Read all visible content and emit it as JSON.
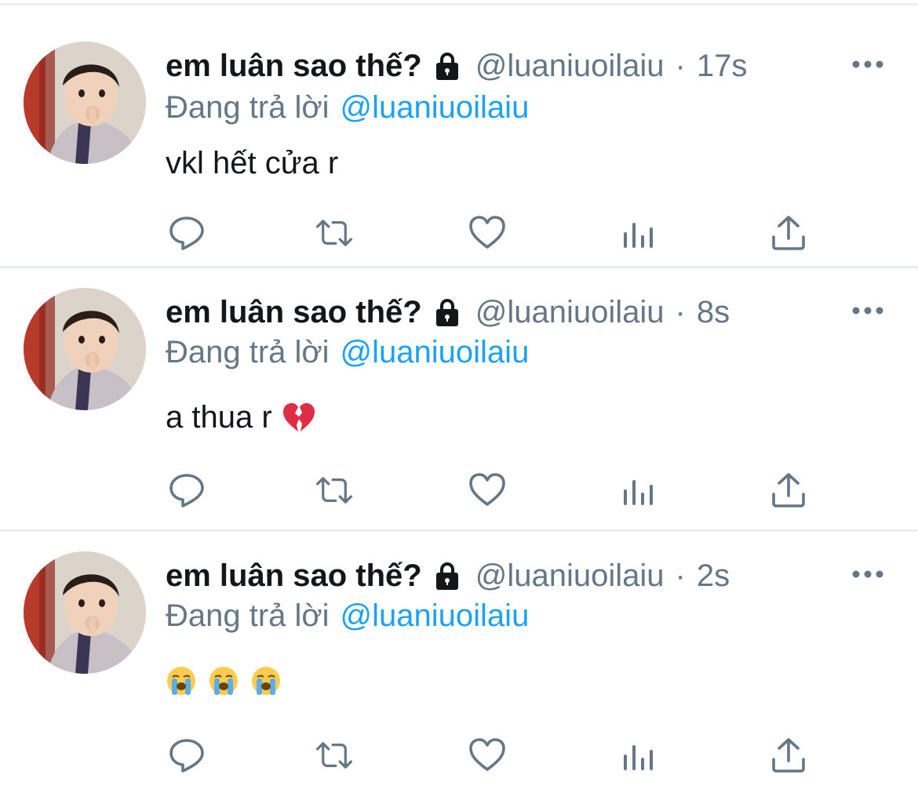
{
  "colors": {
    "text": "#14171a",
    "secondary": "#657786",
    "link": "#1da1f2",
    "divider": "#ebeef0",
    "icon": "#657786"
  },
  "tweets": [
    {
      "display_name": "em luân sao thế?",
      "handle": "@luaniuoilaiu",
      "separator": "·",
      "time": "17s",
      "reply_prefix": "Đang trả lời",
      "reply_to": "@luaniuoilaiu",
      "text": "vkl hết cửa r",
      "emoji": []
    },
    {
      "display_name": "em luân sao thế?",
      "handle": "@luaniuoilaiu",
      "separator": "·",
      "time": "8s",
      "reply_prefix": "Đang trả lời",
      "reply_to": "@luaniuoilaiu",
      "text": "a thua r",
      "emoji": [
        "broken-heart-emoji"
      ]
    },
    {
      "display_name": "em luân sao thế?",
      "handle": "@luaniuoilaiu",
      "separator": "·",
      "time": "2s",
      "reply_prefix": "Đang trả lời",
      "reply_to": "@luaniuoilaiu",
      "text": "",
      "emoji": [
        "loudly-crying-face-emoji",
        "loudly-crying-face-emoji",
        "loudly-crying-face-emoji"
      ]
    }
  ],
  "icons": {
    "lock": "lock-icon",
    "more": "more-icon",
    "reply": "reply-icon",
    "retweet": "retweet-icon",
    "like": "heart-icon",
    "stats": "stats-icon",
    "share": "share-icon"
  }
}
